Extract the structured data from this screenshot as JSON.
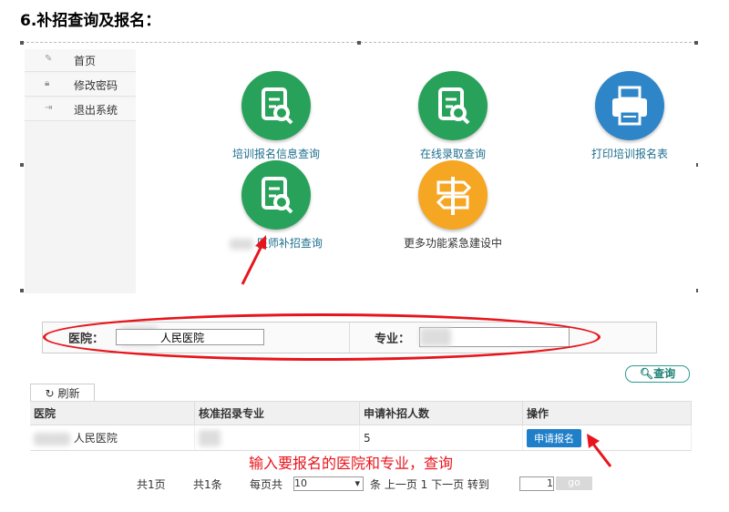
{
  "doc_title": "6.补招查询及报名：",
  "sidebar": {
    "items": [
      {
        "label": "首页",
        "icon": "pencil-icon"
      },
      {
        "label": "修改密码",
        "icon": "lock-icon"
      },
      {
        "label": "退出系统",
        "icon": "logout-icon"
      }
    ]
  },
  "tiles": [
    {
      "label": "培训报名信息查询",
      "icon": "document-search-icon",
      "color": "#28a25a"
    },
    {
      "label": "在线录取查询",
      "icon": "document-search-icon",
      "color": "#28a25a"
    },
    {
      "label": "打印培训报名表",
      "icon": "printer-icon",
      "color": "#2e86c8"
    },
    {
      "label": "医师补招查询",
      "icon": "document-search-icon",
      "color": "#28a25a"
    },
    {
      "label": "更多功能紧急建设中",
      "icon": "signpost-icon",
      "color": "#f5a623"
    }
  ],
  "search": {
    "hospital_label": "医院：",
    "hospital_value": "人民医院",
    "major_label": "专业："
  },
  "query_button": "查询",
  "refresh_button": "刷新",
  "table": {
    "headers": [
      "医院",
      "核准招录专业",
      "申请补招人数",
      "操作"
    ],
    "rows": [
      {
        "hospital": "人民医院",
        "major": "",
        "count": "5",
        "action": "申请报名"
      }
    ]
  },
  "annotation": "输入要报名的医院和专业，查询",
  "pager": {
    "total_pages": "共1页",
    "total_items": "共1条",
    "per_page_label": "每页共",
    "per_page_value": "10",
    "nav": "条 上一页 1 下一页 转到",
    "goto_value": "1",
    "go": "go"
  },
  "colors": {
    "annotation_red": "#e8141c",
    "green": "#28a25a",
    "blue": "#2e86c8",
    "orange": "#f5a623"
  }
}
